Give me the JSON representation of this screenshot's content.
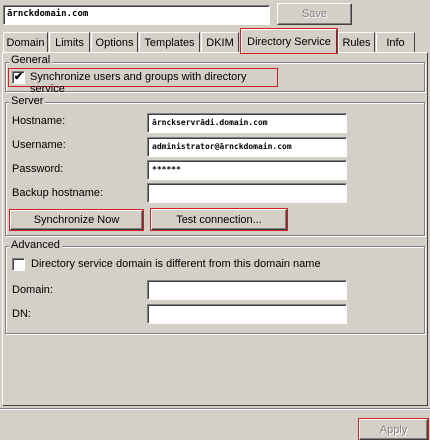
{
  "header": {
    "domain_value": "ārnckdomain.com",
    "save_label": "Save"
  },
  "tabs": [
    {
      "label": "Domain"
    },
    {
      "label": "Limits"
    },
    {
      "label": "Options"
    },
    {
      "label": "Templates"
    },
    {
      "label": "DKIM"
    },
    {
      "label": "Directory Service",
      "active": true
    },
    {
      "label": "Rules"
    },
    {
      "label": "Info"
    }
  ],
  "general": {
    "title": "General",
    "sync_label": "Synchronize users and groups with directory service",
    "sync_checked": true
  },
  "server": {
    "title": "Server",
    "hostname_label": "Hostname:",
    "hostname_value": "ārnckservrādi.domain.com",
    "username_label": "Username:",
    "username_value": "administrator@ārnckdomain.com",
    "password_label": "Password:",
    "password_value": "******",
    "backup_label": "Backup hostname:",
    "backup_value": "",
    "sync_now_label": "Synchronize Now",
    "test_label": "Test connection..."
  },
  "advanced": {
    "title": "Advanced",
    "diff_label": "Directory service domain is different from this domain name",
    "diff_checked": false,
    "domain_label": "Domain:",
    "domain_value": "",
    "dn_label": "DN:",
    "dn_value": ""
  },
  "footer": {
    "apply_label": "Apply"
  },
  "colors": {
    "highlight": "#d21f1f",
    "face": "#d4d0c8"
  }
}
